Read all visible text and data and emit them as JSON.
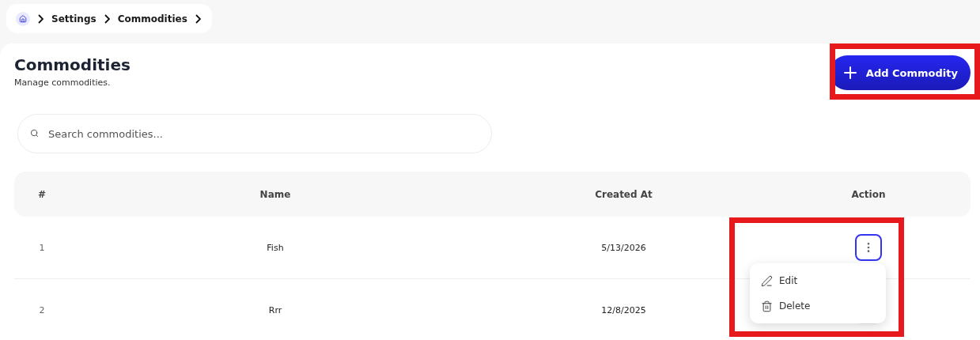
{
  "breadcrumb": [
    {
      "label": "Settings"
    },
    {
      "label": "Commodities"
    }
  ],
  "header": {
    "title": "Commodities",
    "subtitle": "Manage commodities."
  },
  "add_button": {
    "label": "Add Commodity",
    "highlighted": true
  },
  "search": {
    "placeholder": "Search commodities..."
  },
  "table": {
    "columns": [
      "#",
      "Name",
      "Created At",
      "Action"
    ],
    "rows": [
      {
        "index": "1",
        "name": "Fish",
        "created_at": "5/13/2026",
        "menu_open": true,
        "highlighted": true
      },
      {
        "index": "2",
        "name": "Rrr",
        "created_at": "12/8/2025",
        "menu_open": false,
        "highlighted": false
      }
    ]
  },
  "action_menu": [
    {
      "kind": "edit",
      "label": "Edit"
    },
    {
      "kind": "delete",
      "label": "Delete"
    }
  ]
}
